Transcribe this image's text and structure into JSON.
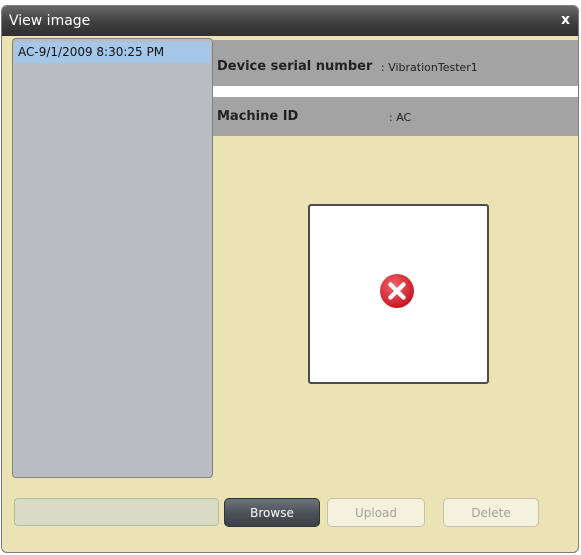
{
  "window": {
    "title": "View image",
    "close_label": "x"
  },
  "image_list": {
    "items": [
      {
        "label": "AC-9/1/2009 8:30:25 PM",
        "selected": true
      }
    ]
  },
  "details": {
    "device_serial_label": "Device serial number",
    "device_serial_value": ": VibrationTester1",
    "machine_id_label": "Machine ID",
    "machine_id_value": ": AC"
  },
  "preview": {
    "status_icon": "error-circle-icon"
  },
  "footer": {
    "file_path_value": "",
    "browse_label": "Browse",
    "upload_label": "Upload",
    "delete_label": "Delete"
  },
  "colors": {
    "dialog_background": "#ebe3b3",
    "titlebar": "#3f3f3f",
    "list_background": "#b9bdc1",
    "selected_item": "#a7c7e8",
    "info_row": "#a3a3a3",
    "error_red": "#d8202c"
  }
}
